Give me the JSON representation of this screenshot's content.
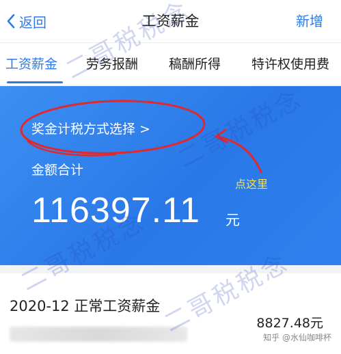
{
  "nav": {
    "back_label": "返回",
    "title": "工资薪金",
    "add_label": "新增"
  },
  "tabs": [
    {
      "label": "工资薪金",
      "active": true
    },
    {
      "label": "劳务报酬",
      "active": false
    },
    {
      "label": "稿酬所得",
      "active": false
    },
    {
      "label": "特许权使用费",
      "active": false
    }
  ],
  "summary": {
    "method_link": "奖金计税方式选择 >",
    "total_label": "金额合计",
    "total_amount": "116397.11",
    "total_unit": "元",
    "hint": "点这里"
  },
  "record": {
    "title": "2020-12 正常工资薪金",
    "amount": "8827.48元"
  },
  "credit": "知乎 @水仙咖啡杯",
  "watermark": "二哥税税念",
  "colors": {
    "brand": "#2f7be6",
    "hint": "#f7e14a",
    "annotation": "#e0282e"
  }
}
